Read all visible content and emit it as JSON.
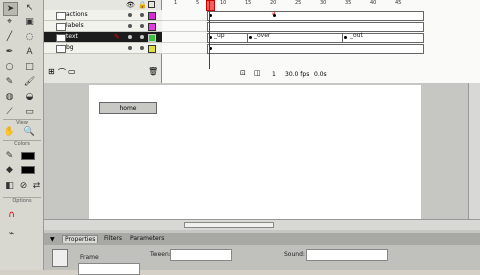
{
  "toolbox": {
    "tools": [
      "arrow",
      "subselect",
      "line",
      "lasso",
      "pen",
      "text",
      "oval",
      "rect",
      "pencil",
      "brush",
      "ink",
      "bucket",
      "dropper",
      "eraser"
    ],
    "view_label": "View",
    "colors_label": "Colors",
    "options_label": "Options"
  },
  "timeline": {
    "ruler": [
      "1",
      "5",
      "10",
      "15",
      "20",
      "25",
      "30",
      "35",
      "40",
      "45"
    ],
    "layers": [
      {
        "name": "actions",
        "active": false
      },
      {
        "name": "labels",
        "active": false
      },
      {
        "name": "text",
        "active": true
      },
      {
        "name": "bg",
        "active": false
      }
    ],
    "frame_labels": [
      "_up",
      "_over",
      "_out"
    ],
    "status": {
      "frame": "1",
      "fps": "30.0 fps",
      "time": "0.0s"
    }
  },
  "stage": {
    "button_label": "home"
  },
  "properties": {
    "tabs": [
      "Properties",
      "Filters",
      "Parameters"
    ],
    "frame_label": "Frame",
    "tween_label": "Tween:",
    "sound_label": "Sound:",
    "tween_value": "None",
    "sound_value": "None"
  },
  "colors": {
    "accent": "#e00000",
    "active_layer": "#1c1c1c"
  }
}
